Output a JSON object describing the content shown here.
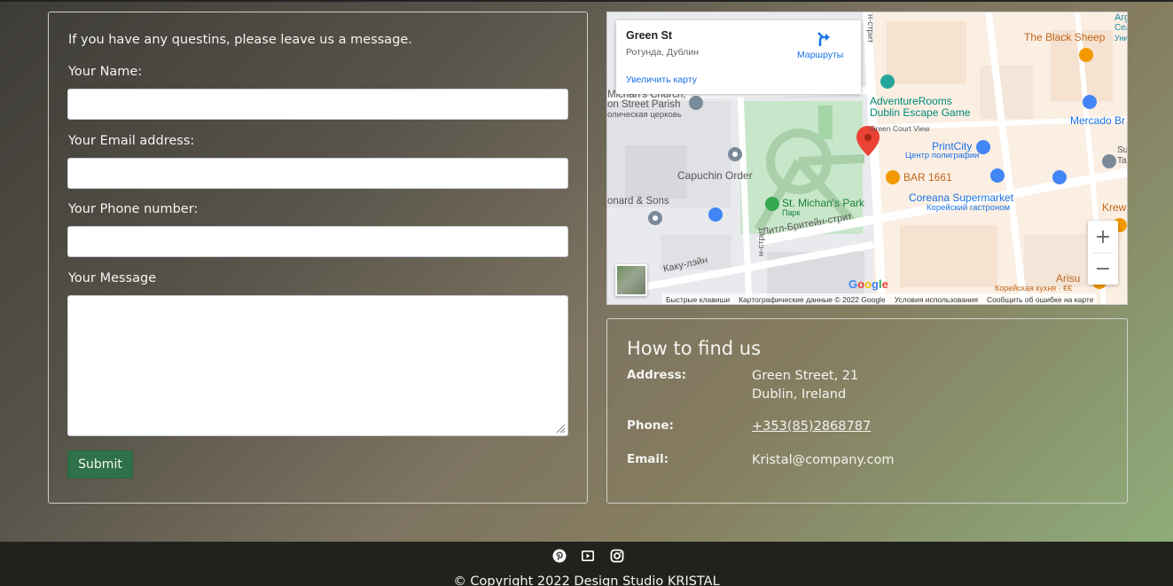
{
  "form": {
    "intro": "If you have any questins, please leave us a message.",
    "name_label": "Your Name:",
    "name_value": "",
    "email_label": "Your Email address:",
    "email_value": "",
    "phone_label": "Your Phone number:",
    "phone_value": "",
    "message_label": "Your Message",
    "message_value": "",
    "submit_label": "Submit"
  },
  "map": {
    "card_title": "Green St",
    "card_subtitle": "Ротунда, Дублин",
    "card_enlarge": "Увеличить карту",
    "card_directions": "Маршруты",
    "labels": {
      "the_black_sheep": "The Black Sheep",
      "adventure_rooms": "AdventureRooms",
      "dublin_escape_game": "Dublin Escape Game",
      "green_court_view": "Green Court View",
      "print_city": "PrintCity",
      "print_city_sub": "Центр полиграфии",
      "bar_1661": "BAR 1661",
      "coreana": "Coreana Supermarket",
      "coreana_sub": "Корейский гастроном",
      "capuchin_order": "Capuchin Order",
      "st_michans_park": "St. Michan's Park",
      "park_sub": "Парк",
      "michans_church": "Michan's Church,",
      "on_street_parish": "on Street Parish",
      "catholic_church": "олическая церковь",
      "onard_sons": "onard & Sons",
      "little_britain": "Литл-Бритейн-стрит",
      "kaku_lane": "Каку-лэйн",
      "mercado": "Mercado Br",
      "arisu": "Arisu",
      "arisu_sub": "Корейская кухня · €€",
      "krew": "Krew",
      "street_vertical": "н-стрит",
      "street_vertical_bottom": "н-стрит",
      "arg": "Arg",
      "cel": "Сел",
      "uni": "Уни",
      "su": "Su",
      "ta": "Ta"
    },
    "zoom_in": "+",
    "zoom_out": "−",
    "google_letters": [
      "G",
      "o",
      "o",
      "g",
      "l",
      "e"
    ],
    "attribution": {
      "shortcuts": "Быстрые клавиши",
      "map_data": "Картографические данные © 2022 Google",
      "terms": "Условия использования",
      "report": "Сообщить об ошибке на карте"
    }
  },
  "find_us": {
    "title": "How to find us",
    "address_label": "Address:",
    "address_line1": "Green Street, 21",
    "address_line2": "Dublin, Ireland",
    "phone_label": "Phone:",
    "phone_value": "+353(85)2868787",
    "email_label": "Email:",
    "email_value": "Kristal@company.com"
  },
  "footer": {
    "social": [
      "pinterest-icon",
      "youtube-icon",
      "instagram-icon"
    ],
    "copyright": "© Copyright 2022 Design Studio KRISTAL"
  },
  "colors": {
    "submit_bg": "#2f7149",
    "footer_bg": "#22221d",
    "link_blue": "#1a73e8",
    "marker_red": "#ea4335",
    "park_green": "#c8e6c9"
  }
}
